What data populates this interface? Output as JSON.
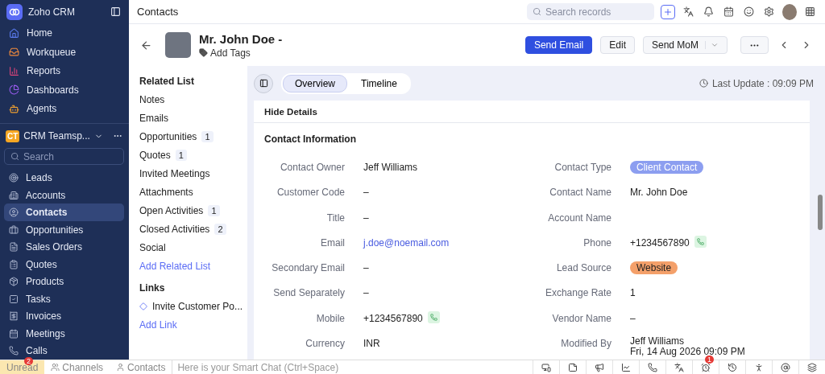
{
  "app": {
    "name": "Zoho CRM"
  },
  "nav_top": [
    {
      "label": "Home"
    },
    {
      "label": "Workqueue"
    },
    {
      "label": "Reports"
    },
    {
      "label": "Dashboards"
    },
    {
      "label": "Agents"
    }
  ],
  "workspace": {
    "badge": "CT",
    "name": "CRM Teamsp...",
    "search_placeholder": "Search"
  },
  "modules": [
    {
      "label": "Leads",
      "selected": false
    },
    {
      "label": "Accounts",
      "selected": false
    },
    {
      "label": "Contacts",
      "selected": true
    },
    {
      "label": "Opportunities",
      "selected": false
    },
    {
      "label": "Sales Orders",
      "selected": false
    },
    {
      "label": "Quotes",
      "selected": false
    },
    {
      "label": "Products",
      "selected": false
    },
    {
      "label": "Tasks",
      "selected": false
    },
    {
      "label": "Invoices",
      "selected": false
    },
    {
      "label": "Meetings",
      "selected": false
    },
    {
      "label": "Calls",
      "selected": false
    }
  ],
  "topbar": {
    "title": "Contacts",
    "search_placeholder": "Search records"
  },
  "record": {
    "name": "Mr. John Doe -",
    "add_tags": "Add Tags",
    "actions": [
      {
        "label": "Send Email",
        "kind": "primary"
      },
      {
        "label": "Edit",
        "kind": "plain"
      },
      {
        "label": "Send MoM",
        "kind": "split"
      }
    ]
  },
  "related": {
    "title": "Related List",
    "items": [
      {
        "label": "Notes"
      },
      {
        "label": "Emails"
      },
      {
        "label": "Opportunities",
        "count": "1"
      },
      {
        "label": "Quotes",
        "count": "1"
      },
      {
        "label": "Invited Meetings"
      },
      {
        "label": "Attachments"
      },
      {
        "label": "Open Activities",
        "count": "1"
      },
      {
        "label": "Closed Activities",
        "count": "2"
      },
      {
        "label": "Social"
      }
    ],
    "add": "Add Related List",
    "links_title": "Links",
    "links": [
      "Invite Customer Po..."
    ],
    "add_link": "Add Link"
  },
  "view_tabs": [
    {
      "label": "Overview",
      "selected": true
    },
    {
      "label": "Timeline",
      "selected": false
    }
  ],
  "last_update": "Last Update : 09:09 PM",
  "details": {
    "toggle": "Hide Details",
    "section": "Contact Information",
    "left": [
      {
        "label": "Contact Owner",
        "kind": "text",
        "value": "Jeff Williams"
      },
      {
        "label": "Customer Code",
        "kind": "text",
        "value": "–"
      },
      {
        "label": "Title",
        "kind": "text",
        "value": "–"
      },
      {
        "label": "Email",
        "kind": "link",
        "value": "j.doe@noemail.com"
      },
      {
        "label": "Secondary Email",
        "kind": "text",
        "value": "–"
      },
      {
        "label": "Send Separately",
        "kind": "text",
        "value": "–"
      },
      {
        "label": "Mobile",
        "kind": "phone",
        "value": "+1234567890"
      },
      {
        "label": "Currency",
        "kind": "text",
        "value": "INR"
      }
    ],
    "right": [
      {
        "label": "Contact Type",
        "kind": "tag",
        "value": "Client Contact",
        "color": "#8c9ef0"
      },
      {
        "label": "Contact Name",
        "kind": "text",
        "value": "Mr. John Doe"
      },
      {
        "label": "Account Name",
        "kind": "empty"
      },
      {
        "label": "Phone",
        "kind": "phone",
        "value": "+1234567890"
      },
      {
        "label": "Lead Source",
        "kind": "tag",
        "value": "Website",
        "color": "#f4a06a"
      },
      {
        "label": "Exchange Rate",
        "kind": "text",
        "value": "1"
      },
      {
        "label": "Vendor Name",
        "kind": "text",
        "value": "–"
      },
      {
        "label": "Modified By",
        "kind": "stacked",
        "value": "Jeff Williams",
        "sub": "Fri, 14 Aug 2026 09:09 PM"
      }
    ]
  },
  "bottom": {
    "tabs": [
      {
        "label": "Unread",
        "selected": true,
        "badge": "2"
      },
      {
        "label": "Channels",
        "selected": false
      },
      {
        "label": "Contacts",
        "selected": false
      }
    ],
    "chat_placeholder": "Here is your Smart Chat (Ctrl+Space)",
    "alarm_badge": "1"
  }
}
